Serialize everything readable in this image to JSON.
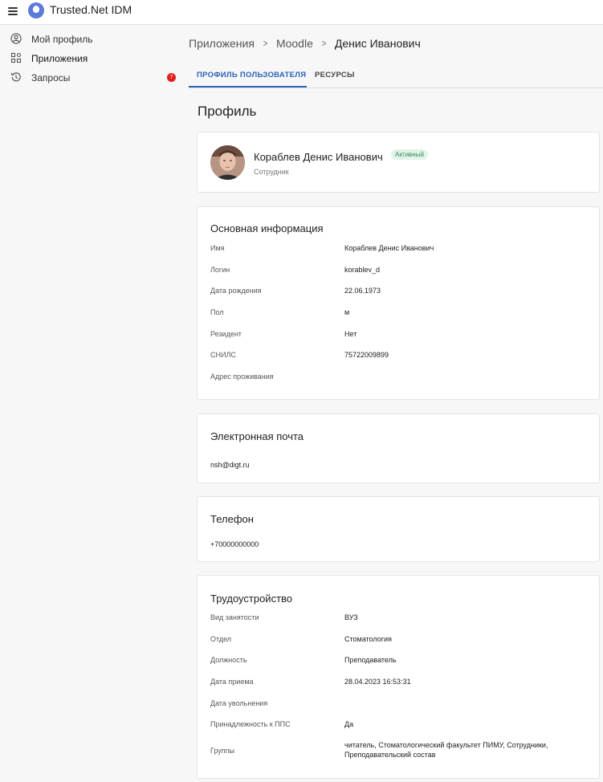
{
  "app": {
    "title": "Trusted.Net IDM"
  },
  "sidebar": {
    "items": [
      {
        "label": "Мой профиль"
      },
      {
        "label": "Приложения"
      },
      {
        "label": "Запросы",
        "badge": "7"
      }
    ]
  },
  "breadcrumb": {
    "items": [
      "Приложения",
      "Moodle",
      "Денис Иванович"
    ]
  },
  "tabs": [
    {
      "label": "ПРОФИЛЬ ПОЛЬЗОВАТЕЛЯ",
      "active": true
    },
    {
      "label": "РЕСУРСЫ",
      "active": false
    }
  ],
  "page": {
    "title": "Профиль"
  },
  "profile": {
    "name": "Кораблев Денис Иванович",
    "status": "Активный",
    "role": "Сотрудник"
  },
  "basic_info": {
    "title": "Основная информация",
    "rows": [
      {
        "label": "Имя",
        "value": "Кораблев Денис Иванович"
      },
      {
        "label": "Логин",
        "value": "korablev_d"
      },
      {
        "label": "Дата рождения",
        "value": "22.06.1973"
      },
      {
        "label": "Пол",
        "value": "м"
      },
      {
        "label": "Резидент",
        "value": "Нет"
      },
      {
        "label": "СНИЛС",
        "value": "75722009899"
      },
      {
        "label": "Адрес проживания",
        "value": ""
      }
    ]
  },
  "email": {
    "title": "Электронная почта",
    "value": "nsh@digt.ru"
  },
  "phone": {
    "title": "Телефон",
    "value": "+70000000000"
  },
  "employment": {
    "title": "Трудоустройство",
    "rows": [
      {
        "label": "Вид занятости",
        "value": "ВУЗ"
      },
      {
        "label": "Отдел",
        "value": "Стоматология"
      },
      {
        "label": "Должность",
        "value": "Преподаватель"
      },
      {
        "label": "Дата приема",
        "value": "28.04.2023 16:53:31"
      },
      {
        "label": "Дата увольнения",
        "value": ""
      },
      {
        "label": "Принадлежность к ППС",
        "value": "Да"
      },
      {
        "label": "Группы",
        "value_line1": "читатель, Стоматологический факультет ПИМУ, Сотрудники,",
        "value_line2": "Преподавательский состав"
      }
    ]
  },
  "colors": {
    "accent": "#2a63b8",
    "badge": "#e0201b",
    "status_bg": "#e2f4ea",
    "status_text": "#2e8b57"
  },
  "icons": {
    "menu": "hamburger-icon",
    "logo": "trusted-net-logo",
    "my_profile": "user-circle-icon",
    "applications": "apps-grid-icon",
    "requests": "history-icon",
    "breadcrumb_separator": "chevron-right-icon"
  }
}
